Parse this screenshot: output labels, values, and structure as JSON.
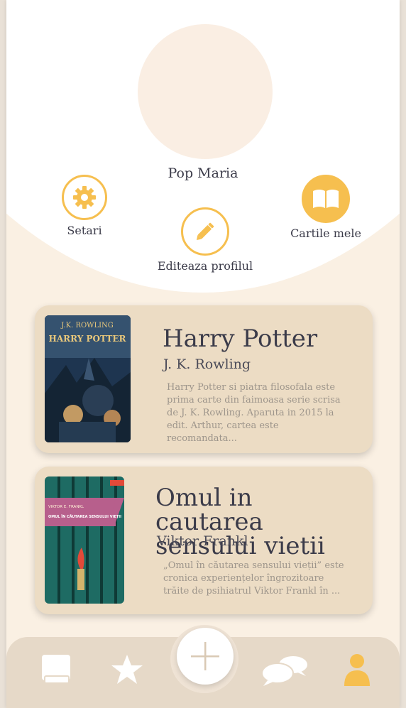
{
  "profile": {
    "name": "Pop Maria"
  },
  "actions": {
    "settings_label": "Setari",
    "edit_label": "Editeaza profilul",
    "books_label": "Cartile mele"
  },
  "books": [
    {
      "title": "Harry Potter",
      "author": "J. K. Rowling",
      "description": "Harry Potter si piatra filosofala este prima carte din faimoasa serie scrisa de J. K. Rowling. Aparuta in 2015 la edit. Arthur, cartea este recomandata...",
      "cover_author": "J.K. ROWLING",
      "cover_title": "HARRY POTTER"
    },
    {
      "title": "Omul in cautarea sensului vietii",
      "author": "Viktor Frankl",
      "description": "„Omul în căutarea sensului vieții” este cronica experiențelor îngrozitoare trăite de psihiatrul Viktor Frankl în ...",
      "cover_author": "VIKTOR E. FRANKL",
      "cover_title": "OMUL ÎN CĂUTAREA SENSULUI VIEȚII"
    }
  ],
  "colors": {
    "accent": "#f6bf4f",
    "card_bg": "#ecdcc4",
    "page_bg": "#faf0e3",
    "text": "#3b3b49"
  },
  "nav": {
    "items": [
      "book-icon",
      "star-icon",
      "add-icon",
      "chat-icon",
      "user-icon"
    ]
  }
}
